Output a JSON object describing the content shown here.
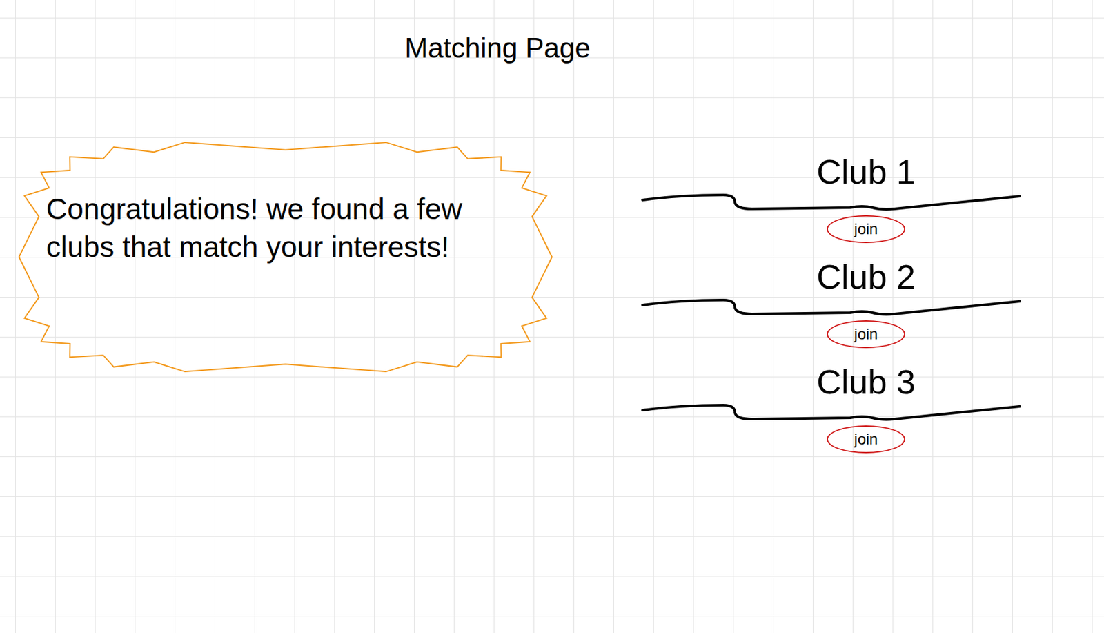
{
  "page": {
    "title": "Matching Page"
  },
  "message": "Congratulations! we found a few clubs that match your interests!",
  "clubs": [
    {
      "name": "Club 1",
      "action": "join"
    },
    {
      "name": "Club 2",
      "action": "join"
    },
    {
      "name": "Club 3",
      "action": "join"
    }
  ]
}
